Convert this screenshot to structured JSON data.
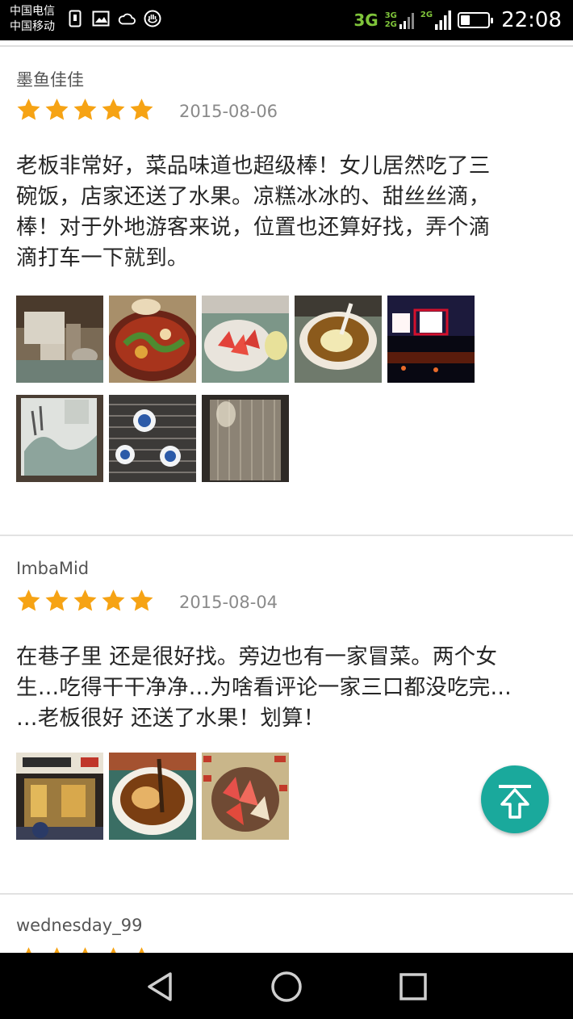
{
  "status_bar": {
    "carrier_1": "中国电信",
    "carrier_2": "中国移动",
    "network_main": "3G",
    "network_a": "3G",
    "network_b": "2G",
    "network_c": "2G",
    "time": "22:08",
    "battery_level": 0.35,
    "icons_left": [
      "sim-icon",
      "image-icon",
      "cloud-icon",
      "hand-icon"
    ]
  },
  "reviews": [
    {
      "username": "墨鱼佳佳",
      "rating": 5,
      "date": "2015-08-06",
      "lines": [
        "老板非常好，菜品味道也超级棒！女儿居然吃了三",
        "碗饭，店家还送了水果。凉糕冰冰的、甜丝丝滴，",
        "棒！对于外地游客来说，位置也还算好找，弄个滴",
        "滴打车一下就到。"
      ],
      "photos": [
        "table-setting",
        "hotpot-dish",
        "watermelon-plate",
        "dessert-bowl",
        "night-sign",
        "wall-painting",
        "brick-wall-plates",
        "glass-door"
      ]
    },
    {
      "username": "ImbaMid",
      "rating": 5,
      "date": "2015-08-04",
      "lines": [
        "在巷子里  还是很好找。旁边也有一家冒菜。两个女",
        "生…吃得干干净净…为啥看评论一家三口都没吃完…",
        "…老板很好 还送了水果！划算！"
      ],
      "photos": [
        "storefront",
        "dessert-bowl-2",
        "watermelon-bowl"
      ]
    },
    {
      "username": "wednesday_99",
      "rating": 5
    }
  ],
  "colors": {
    "star": "#f6a314",
    "fab": "#1aa99c",
    "divider": "#e2e2e2"
  },
  "fab_icon": "back-to-top-icon",
  "nav": [
    "back-icon",
    "home-icon",
    "recents-icon"
  ]
}
